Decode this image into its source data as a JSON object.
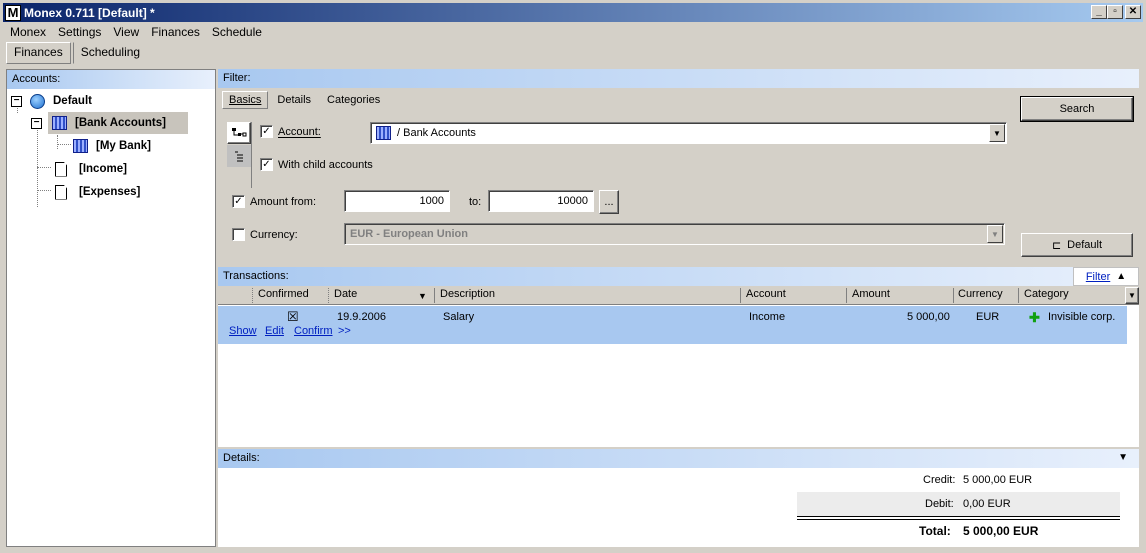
{
  "window": {
    "title": "Monex 0.711 [Default] *",
    "app_icon_letter": "M"
  },
  "menu": [
    "Monex",
    "Settings",
    "View",
    "Finances",
    "Schedule"
  ],
  "top_tabs": [
    {
      "label": "Finances",
      "active": true
    },
    {
      "label": "Scheduling",
      "active": false
    }
  ],
  "accounts_panel": {
    "header": "Accounts:",
    "tree": [
      {
        "label": "Default",
        "icon": "globe-icon",
        "expander": "−"
      },
      {
        "label": "[Bank Accounts]",
        "icon": "bank-icon",
        "expander": "−",
        "selected": true
      },
      {
        "label": "[My Bank]",
        "icon": "bank-icon"
      },
      {
        "label": "[Income]",
        "icon": "document-icon"
      },
      {
        "label": "[Expenses]",
        "icon": "document-icon"
      }
    ]
  },
  "filter": {
    "header": "Filter:",
    "tabs": [
      "Basics",
      "Details",
      "Categories"
    ],
    "account_label": "Account:",
    "account_value": "/ Bank Accounts",
    "account_checked": true,
    "child_accounts_label": "With child accounts",
    "child_accounts_checked": true,
    "amount_from_label": "Amount from:",
    "amount_from_checked": true,
    "amount_from": "1000",
    "amount_to_label": "to:",
    "amount_to": "10000",
    "ellipsis": "...",
    "currency_label": "Currency:",
    "currency_checked": false,
    "currency_value": "EUR - European Union",
    "search_button": "Search",
    "default_button": "Default"
  },
  "transactions": {
    "header": "Transactions:",
    "filter_link": "Filter",
    "columns": [
      "Confirmed",
      "Date",
      "Description",
      "Account",
      "Amount",
      "Currency",
      "Category"
    ],
    "rows": [
      {
        "confirmed": "☒",
        "date": "19.9.2006",
        "description": "Salary",
        "account": "Income",
        "amount": "5 000,00",
        "currency": "EUR",
        "category": "Invisible corp.",
        "actions": [
          "Show",
          "Edit",
          "Confirm",
          ">>"
        ]
      }
    ]
  },
  "details": {
    "header": "Details:",
    "credit_label": "Credit:",
    "credit_value": "5 000,00  EUR",
    "debit_label": "Debit:",
    "debit_value": "0,00  EUR",
    "total_label": "Total:",
    "total_value": "5 000,00  EUR"
  },
  "colors": {
    "title_bar": "#0a246a",
    "section_header": "#a8c8f0",
    "selected_row": "#a8c8f0",
    "link": "#0020c0"
  }
}
